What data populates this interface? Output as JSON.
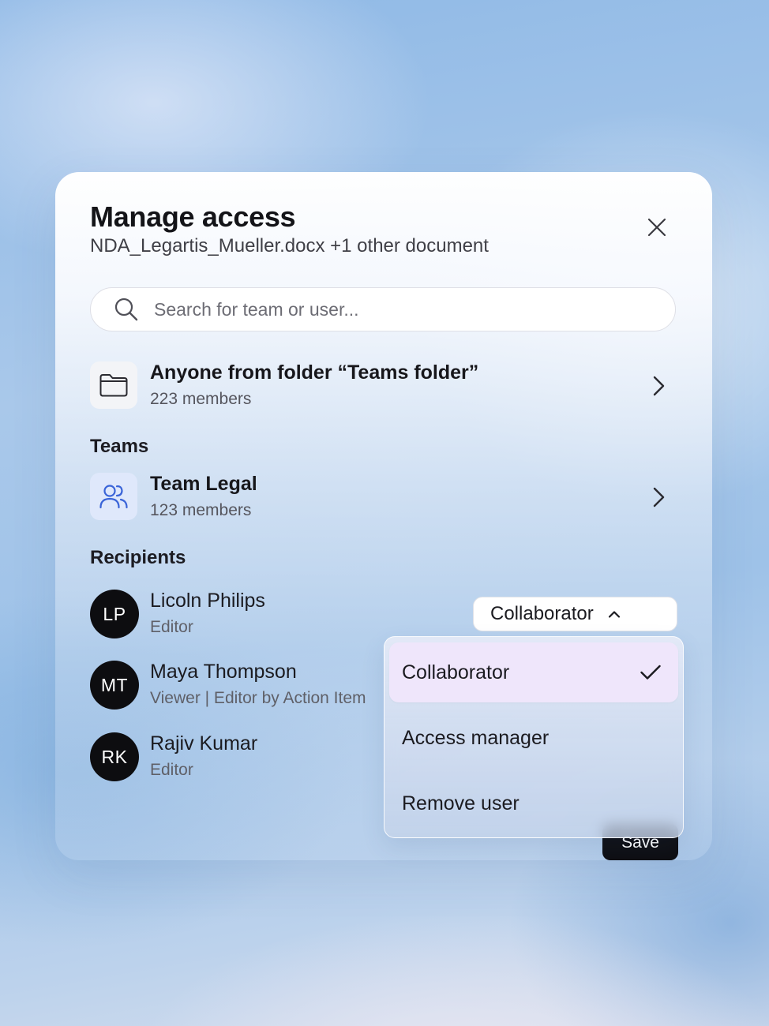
{
  "dialog": {
    "title": "Manage access",
    "subtitle": "NDA_Legartis_Mueller.docx +1 other document"
  },
  "search": {
    "placeholder": "Search for team or user..."
  },
  "folder_access": {
    "title": "Anyone from folder “Teams folder”",
    "members": "223 members"
  },
  "teams": {
    "label": "Teams",
    "items": [
      {
        "name": "Team Legal",
        "members": "123 members"
      }
    ]
  },
  "recipients": {
    "label": "Recipients",
    "items": [
      {
        "initials": "LP",
        "name": "Licoln Philips",
        "role": "Editor"
      },
      {
        "initials": "MT",
        "name": "Maya Thompson",
        "role": "Viewer | Editor by Action Item"
      },
      {
        "initials": "RK",
        "name": "Rajiv Kumar",
        "role": "Editor"
      }
    ]
  },
  "role_select": {
    "value": "Collaborator"
  },
  "role_menu": {
    "options": [
      {
        "label": "Collaborator",
        "selected": true
      },
      {
        "label": "Access manager",
        "selected": false
      },
      {
        "label": "Remove user",
        "selected": false
      }
    ]
  },
  "footer": {
    "save_label": "Save"
  },
  "colors": {
    "accent": "#3a64d8",
    "selected_option_bg": "#efe6fb",
    "avatar_bg": "#0d0d10",
    "button_bg": "#0e0e12"
  },
  "icons": {
    "close": "close-icon",
    "search": "search-icon",
    "folder": "folder-icon",
    "team": "users-icon",
    "chevron_right": "chevron-right-icon",
    "chevron_up": "chevron-up-icon",
    "check": "check-icon"
  }
}
